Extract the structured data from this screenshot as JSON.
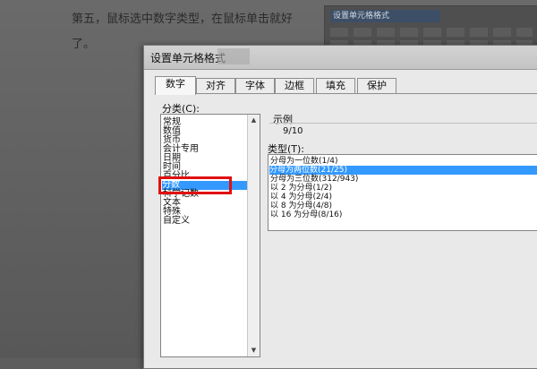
{
  "article": {
    "line1": "第五，鼠标选中数字类型，在鼠标单击就好",
    "line2": "了。"
  },
  "background_thumb": {
    "title": "设置单元格格式"
  },
  "dialog": {
    "title": "设置单元格格式",
    "tabs": [
      {
        "label": "数字",
        "active": true
      },
      {
        "label": "对齐",
        "active": false
      },
      {
        "label": "字体",
        "active": false
      },
      {
        "label": "边框",
        "active": false
      },
      {
        "label": "填充",
        "active": false
      },
      {
        "label": "保护",
        "active": false
      }
    ],
    "category_label": "分类(C):",
    "categories": [
      "常规",
      "数值",
      "货币",
      "会计专用",
      "日期",
      "时间",
      "百分比",
      "分数",
      "科学记数",
      "文本",
      "特殊",
      "自定义"
    ],
    "selected_category": "分数",
    "sample_label": "示例",
    "sample_value": "9/10",
    "type_label": "类型(T):",
    "types": [
      "分母为一位数(1/4)",
      "分母为两位数(21/25)",
      "分母为三位数(312/943)",
      "以 2 为分母(1/2)",
      "以 4 为分母(2/4)",
      "以 8 为分母(4/8)",
      "以 16 为分母(8/16)"
    ],
    "selected_type": "分母为两位数(21/25)"
  },
  "colors": {
    "selection": "#3399ff",
    "highlight_box": "#e01010"
  },
  "icons": {
    "scroll_up": "triangle-up-icon",
    "scroll_down": "triangle-down-icon"
  }
}
